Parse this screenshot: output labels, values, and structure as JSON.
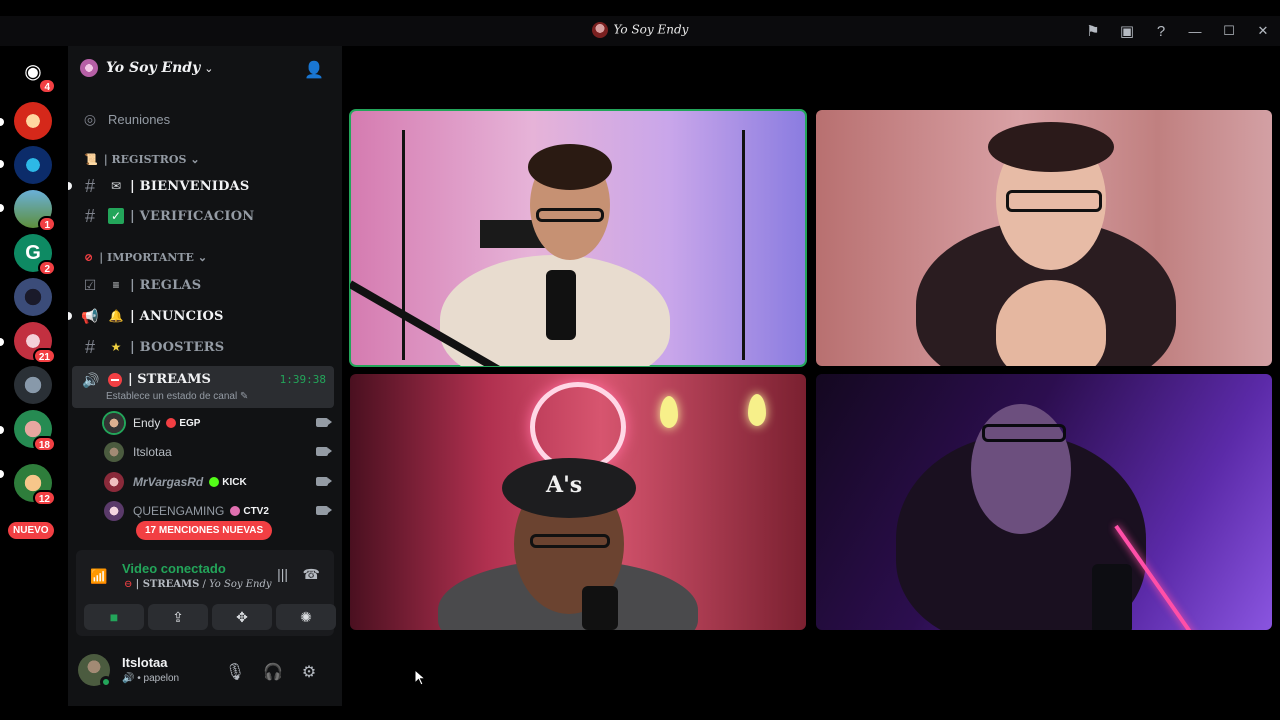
{
  "window": {
    "title": "Yo Soy Endy",
    "icons": [
      "flag-icon",
      "inbox-icon",
      "help-icon"
    ],
    "controls": [
      "minimize-icon",
      "maximize-icon",
      "close-icon"
    ]
  },
  "servers": {
    "home_badge": "4",
    "badges": [
      "1",
      "2",
      "21",
      "18",
      "12"
    ],
    "nuevo_label": "NUEVO"
  },
  "guild": {
    "name": "Yo Soy Endy"
  },
  "channels": {
    "reuniones": "Reuniones",
    "cat_registros": "| REGISTROS",
    "bienvenidas": "| BIENVENIDAS",
    "verificacion": "| VERIFICACION",
    "cat_importante": "| IMPORTANTE",
    "reglas": "| REGLAS",
    "anuncios": "| ANUNCIOS",
    "boosters": "| BOOSTERS",
    "streams": "| STREAMS",
    "streams_timer": "1:39:38",
    "streams_status": "Establece un estado de canal"
  },
  "members": [
    {
      "name": "Endy",
      "tag": "EGP"
    },
    {
      "name": "Itslotaa",
      "tag": ""
    },
    {
      "name": "MrVargasRd",
      "tag": "KICK"
    },
    {
      "name": "QUEENGAMING",
      "tag": "CTV2"
    }
  ],
  "mentions_label": "17 MENCIONES NUEVAS",
  "voice": {
    "title": "Video conectado",
    "channel": "| STREAMS",
    "separator": " / ",
    "server": "Yo Soy Endy"
  },
  "user": {
    "name": "Itslotaa",
    "status": "• papelon"
  },
  "colors": {
    "accent_green": "#23a55a",
    "danger_red": "#f23f43",
    "sidebar_bg": "#111214"
  }
}
